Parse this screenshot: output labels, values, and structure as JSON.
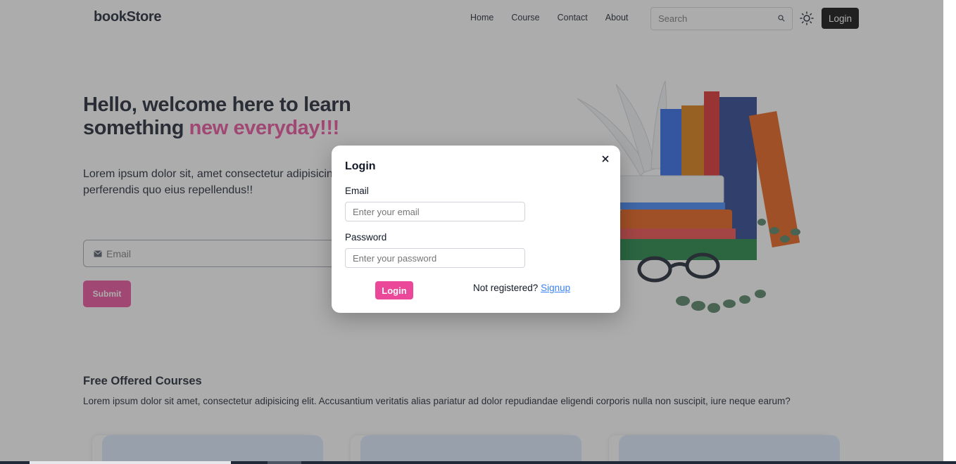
{
  "nav": {
    "brand": "bookStore",
    "links": [
      "Home",
      "Course",
      "Contact",
      "About"
    ],
    "search_placeholder": "Search",
    "login_label": "Login"
  },
  "hero": {
    "title_part1": "Hello, welcome here to learn something ",
    "title_accent": "new everyday!!!",
    "paragraph": "Lorem ipsum dolor sit, amet consectetur adipisicing elit. Voluptatem explicabo, perferendis quo eius repellendus!!",
    "email_placeholder": "Email",
    "submit_label": "Submit"
  },
  "courses": {
    "title": "Free Offered Courses",
    "description": "Lorem ipsum dolor sit amet, consectetur adipisicing elit. Accusantium veritatis alias pariatur ad dolor repudiandae eligendi corporis nulla non suscipit, iure neque earum?"
  },
  "modal": {
    "title": "Login",
    "email_label": "Email",
    "email_placeholder": "Enter your email",
    "password_label": "Password",
    "password_placeholder": "Enter your password",
    "login_label": "Login",
    "not_registered": "Not registered?",
    "signup_label": "Signup"
  },
  "colors": {
    "accent": "#ec4899",
    "link": "#3b82f6",
    "dark": "#000000"
  },
  "icons": [
    "search-icon",
    "sun-icon",
    "mail-icon",
    "close-icon"
  ]
}
